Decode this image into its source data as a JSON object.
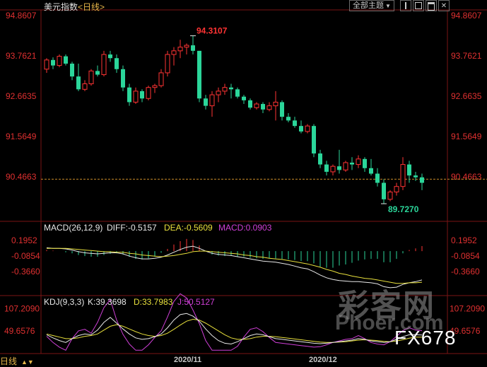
{
  "header": {
    "symbol": "美元指数",
    "timeframe": "<日线>"
  },
  "toolbar": {
    "theme_label": "全部主题",
    "theme_arrow": "▼"
  },
  "bottom": {
    "period_label": "日线",
    "arrows": "▲▼",
    "dates": [
      "2020/11",
      "2020/12"
    ]
  },
  "watermark": {
    "brand_cn": "彩客网",
    "site": "Phoer.com",
    "code": "FX678"
  },
  "colors": {
    "up": "#ff3333",
    "down": "#2bd69a",
    "axis_text": "#e03030",
    "grid": "#7a1515",
    "dea": "#e8e03c",
    "diff": "#e8e8e8",
    "macd": "#d040d8",
    "kdj_j": "#d040d8"
  },
  "chart_data": [
    {
      "type": "candlestick",
      "name": "price",
      "y_ticks": [
        "94.8607",
        "93.7621",
        "92.6635",
        "91.5649",
        "90.4663"
      ],
      "y_tick_values": [
        94.8607,
        93.7621,
        92.6635,
        91.5649,
        90.4663
      ],
      "ylim": [
        89.5,
        94.9
      ],
      "high_label": "94.3107",
      "low_label": "89.7270",
      "last_price": 90.4,
      "candles": [
        [
          93.4,
          93.7,
          93.3,
          93.65
        ],
        [
          93.65,
          93.72,
          93.4,
          93.5
        ],
        [
          93.5,
          93.8,
          93.45,
          93.75
        ],
        [
          93.75,
          93.8,
          93.5,
          93.55
        ],
        [
          93.55,
          93.6,
          93.1,
          93.2
        ],
        [
          93.2,
          93.55,
          92.8,
          92.85
        ],
        [
          92.85,
          93.1,
          92.8,
          93.0
        ],
        [
          93.0,
          93.4,
          92.95,
          93.35
        ],
        [
          93.35,
          93.5,
          93.2,
          93.25
        ],
        [
          93.25,
          93.9,
          93.2,
          93.8
        ],
        [
          93.8,
          93.9,
          93.6,
          93.7
        ],
        [
          93.7,
          93.8,
          93.3,
          93.4
        ],
        [
          93.4,
          93.5,
          92.8,
          92.9
        ],
        [
          92.9,
          93.0,
          92.4,
          92.5
        ],
        [
          92.5,
          92.9,
          92.45,
          92.8
        ],
        [
          92.8,
          92.85,
          92.5,
          92.6
        ],
        [
          92.6,
          92.95,
          92.55,
          92.9
        ],
        [
          92.9,
          93.0,
          92.75,
          92.95
        ],
        [
          92.95,
          93.4,
          92.9,
          93.3
        ],
        [
          93.3,
          93.9,
          93.2,
          93.8
        ],
        [
          93.8,
          94.0,
          93.5,
          93.9
        ],
        [
          93.9,
          94.2,
          93.7,
          94.0
        ],
        [
          94.0,
          94.1,
          93.8,
          94.05
        ],
        [
          94.05,
          94.31,
          93.8,
          93.9
        ],
        [
          93.9,
          93.9,
          92.5,
          92.6
        ],
        [
          92.6,
          92.7,
          92.3,
          92.4
        ],
        [
          92.4,
          92.8,
          92.1,
          92.7
        ],
        [
          92.7,
          92.9,
          92.5,
          92.8
        ],
        [
          92.8,
          93.0,
          92.7,
          92.9
        ],
        [
          92.9,
          93.0,
          92.6,
          92.85
        ],
        [
          92.85,
          92.9,
          92.6,
          92.65
        ],
        [
          92.65,
          92.7,
          92.45,
          92.55
        ],
        [
          92.55,
          92.6,
          92.3,
          92.35
        ],
        [
          92.35,
          92.5,
          92.3,
          92.45
        ],
        [
          92.45,
          92.5,
          92.2,
          92.3
        ],
        [
          92.3,
          92.5,
          92.25,
          92.4
        ],
        [
          92.4,
          92.8,
          92.0,
          92.5
        ],
        [
          92.5,
          92.55,
          92.0,
          92.1
        ],
        [
          92.1,
          92.2,
          91.95,
          92.0
        ],
        [
          92.0,
          92.1,
          91.8,
          91.85
        ],
        [
          91.85,
          92.0,
          91.65,
          91.7
        ],
        [
          91.7,
          91.9,
          91.65,
          91.85
        ],
        [
          91.85,
          91.9,
          91.0,
          91.1
        ],
        [
          91.1,
          91.2,
          90.7,
          90.8
        ],
        [
          90.8,
          90.9,
          90.5,
          90.6
        ],
        [
          90.6,
          90.8,
          90.5,
          90.75
        ],
        [
          90.75,
          91.2,
          90.55,
          90.65
        ],
        [
          90.65,
          90.9,
          90.6,
          90.85
        ],
        [
          90.85,
          91.0,
          90.65,
          90.8
        ],
        [
          90.8,
          91.05,
          90.7,
          90.95
        ],
        [
          90.95,
          91.0,
          90.6,
          90.7
        ],
        [
          90.7,
          90.95,
          90.5,
          90.55
        ],
        [
          90.55,
          90.7,
          90.2,
          90.3
        ],
        [
          90.3,
          90.4,
          89.73,
          89.85
        ],
        [
          89.85,
          90.1,
          89.8,
          90.05
        ],
        [
          90.05,
          90.3,
          89.95,
          90.2
        ],
        [
          90.2,
          91.0,
          90.1,
          90.8
        ],
        [
          90.8,
          90.9,
          90.3,
          90.5
        ],
        [
          90.5,
          90.6,
          90.35,
          90.45
        ],
        [
          90.45,
          90.55,
          90.1,
          90.3
        ]
      ]
    },
    {
      "type": "macd",
      "name": "MACD",
      "params": "MACD(26,12,9)",
      "diff_label": "DIFF:-0.5157",
      "dea_label": "DEA:-0.5609",
      "macd_label": "MACD:0.0903",
      "y_ticks": [
        "0.1952",
        "-0.0854",
        "-0.3660"
      ],
      "y_tick_values": [
        0.1952,
        -0.0854,
        -0.366
      ],
      "ylim": [
        -0.75,
        0.32
      ],
      "diff": [
        0.06,
        0.05,
        0.05,
        0.04,
        0.02,
        -0.01,
        -0.03,
        -0.04,
        -0.05,
        -0.04,
        -0.03,
        -0.03,
        -0.05,
        -0.09,
        -0.12,
        -0.14,
        -0.14,
        -0.13,
        -0.11,
        -0.07,
        -0.02,
        0.03,
        0.07,
        0.09,
        0.05,
        0.0,
        -0.04,
        -0.06,
        -0.07,
        -0.08,
        -0.1,
        -0.12,
        -0.14,
        -0.16,
        -0.18,
        -0.19,
        -0.2,
        -0.22,
        -0.24,
        -0.27,
        -0.3,
        -0.32,
        -0.37,
        -0.43,
        -0.48,
        -0.51,
        -0.53,
        -0.54,
        -0.55,
        -0.55,
        -0.56,
        -0.57,
        -0.59,
        -0.64,
        -0.66,
        -0.65,
        -0.6,
        -0.57,
        -0.55,
        -0.52
      ],
      "dea": [
        0.05,
        0.05,
        0.05,
        0.05,
        0.04,
        0.03,
        0.02,
        0.01,
        0.0,
        -0.01,
        -0.01,
        -0.02,
        -0.02,
        -0.04,
        -0.05,
        -0.07,
        -0.08,
        -0.09,
        -0.1,
        -0.09,
        -0.08,
        -0.06,
        -0.04,
        -0.01,
        0.0,
        0.0,
        -0.01,
        -0.02,
        -0.03,
        -0.04,
        -0.05,
        -0.07,
        -0.08,
        -0.1,
        -0.11,
        -0.13,
        -0.14,
        -0.15,
        -0.17,
        -0.19,
        -0.21,
        -0.23,
        -0.26,
        -0.29,
        -0.33,
        -0.36,
        -0.4,
        -0.42,
        -0.45,
        -0.47,
        -0.49,
        -0.5,
        -0.52,
        -0.54,
        -0.56,
        -0.58,
        -0.58,
        -0.57,
        -0.57,
        -0.56
      ],
      "macd": [
        0.02,
        0.01,
        0.0,
        -0.02,
        -0.04,
        -0.07,
        -0.09,
        -0.1,
        -0.1,
        -0.07,
        -0.05,
        -0.04,
        -0.06,
        -0.1,
        -0.14,
        -0.15,
        -0.13,
        -0.1,
        -0.03,
        0.04,
        0.12,
        0.18,
        0.22,
        0.2,
        0.1,
        0.0,
        -0.06,
        -0.08,
        -0.09,
        -0.08,
        -0.1,
        -0.1,
        -0.12,
        -0.13,
        -0.14,
        -0.13,
        -0.13,
        -0.14,
        -0.15,
        -0.16,
        -0.18,
        -0.18,
        -0.22,
        -0.28,
        -0.3,
        -0.3,
        -0.26,
        -0.24,
        -0.21,
        -0.17,
        -0.15,
        -0.14,
        -0.14,
        -0.2,
        -0.2,
        -0.14,
        -0.04,
        0.02,
        0.05,
        0.09
      ]
    },
    {
      "type": "kdj",
      "name": "KDJ",
      "params": "KDJ(9,3,3)",
      "k_label": "K:39.3698",
      "d_label": "D:33.7983",
      "j_label": "J:50.5127",
      "y_ticks": [
        "107.2090",
        "49.6576"
      ],
      "y_tick_values": [
        107.209,
        49.6576
      ],
      "ylim": [
        -5,
        112
      ],
      "k": [
        40,
        32,
        25,
        20,
        30,
        38,
        42,
        40,
        52,
        72,
        85,
        70,
        55,
        42,
        32,
        28,
        30,
        35,
        42,
        58,
        78,
        92,
        95,
        88,
        75,
        55,
        38,
        25,
        18,
        16,
        22,
        30,
        38,
        42,
        40,
        35,
        30,
        28,
        26,
        24,
        22,
        20,
        18,
        17,
        18,
        20,
        22,
        24,
        26,
        30,
        28,
        24,
        22,
        20,
        22,
        28,
        35,
        40,
        40,
        39.37
      ],
      "d": [
        42,
        38,
        34,
        30,
        30,
        32,
        36,
        38,
        42,
        52,
        62,
        66,
        62,
        55,
        48,
        42,
        38,
        36,
        38,
        44,
        54,
        65,
        75,
        80,
        78,
        70,
        60,
        50,
        40,
        32,
        28,
        28,
        30,
        34,
        36,
        36,
        35,
        33,
        31,
        29,
        27,
        25,
        23,
        21,
        20,
        20,
        21,
        22,
        24,
        26,
        27,
        26,
        25,
        23,
        22,
        24,
        27,
        31,
        34,
        33.8
      ],
      "j": [
        36,
        20,
        8,
        0,
        30,
        50,
        54,
        44,
        72,
        110,
        131,
        78,
        41,
        16,
        0,
        0,
        14,
        33,
        50,
        86,
        126,
        146,
        135,
        104,
        69,
        25,
        0,
        0,
        0,
        0,
        10,
        34,
        54,
        58,
        48,
        33,
        20,
        18,
        16,
        14,
        12,
        10,
        8,
        9,
        14,
        20,
        24,
        28,
        30,
        38,
        30,
        20,
        16,
        14,
        22,
        36,
        51,
        58,
        52,
        50.51
      ]
    }
  ]
}
